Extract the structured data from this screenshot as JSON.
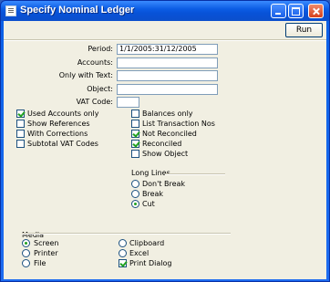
{
  "window": {
    "title": "Specify Nominal Ledger"
  },
  "toolbar": {
    "run_label": "Run"
  },
  "fields": {
    "period": {
      "label": "Period:",
      "value": "1/1/2005:31/12/2005"
    },
    "accounts": {
      "label": "Accounts:",
      "value": ""
    },
    "only_with_text": {
      "label": "Only with Text:",
      "value": ""
    },
    "object": {
      "label": "Object:",
      "value": ""
    },
    "vat_code": {
      "label": "VAT Code:",
      "value": ""
    }
  },
  "options_left": [
    {
      "label": "Used Accounts only",
      "checked": true
    },
    {
      "label": "Show References",
      "checked": false
    },
    {
      "label": "With Corrections",
      "checked": false
    },
    {
      "label": "Subtotal VAT Codes",
      "checked": false
    }
  ],
  "options_right": [
    {
      "label": "Balances only",
      "checked": false
    },
    {
      "label": "List Transaction Nos",
      "checked": false
    },
    {
      "label": "Not Reconciled",
      "checked": true
    },
    {
      "label": "Reconciled",
      "checked": true
    },
    {
      "label": "Show Object",
      "checked": false
    }
  ],
  "long_lines": {
    "heading": "Long Lines",
    "options": [
      {
        "label": "Don't Break",
        "selected": false
      },
      {
        "label": "Break",
        "selected": false
      },
      {
        "label": "Cut",
        "selected": true
      }
    ]
  },
  "media": {
    "heading": "Media",
    "left": [
      {
        "label": "Screen",
        "selected": true
      },
      {
        "label": "Printer",
        "selected": false
      },
      {
        "label": "File",
        "selected": false
      }
    ],
    "right_radios": [
      {
        "label": "Clipboard",
        "selected": false
      },
      {
        "label": "Excel",
        "selected": false
      }
    ],
    "print_dialog": {
      "label": "Print Dialog",
      "checked": true
    }
  }
}
